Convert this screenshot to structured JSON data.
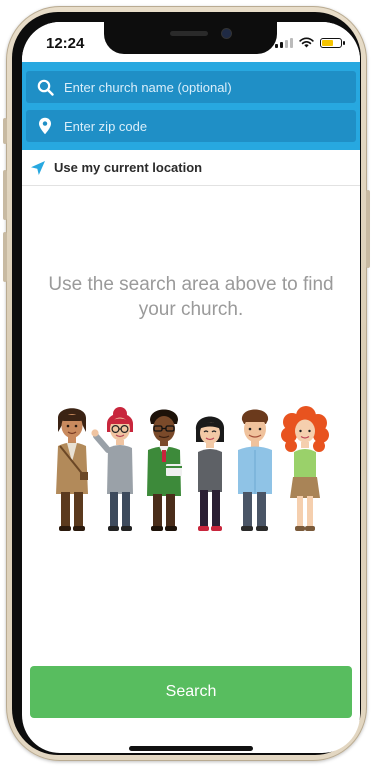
{
  "status_bar": {
    "time": "12:24",
    "battery_level": 0.7
  },
  "search": {
    "church_name_placeholder": "Enter church name (optional)",
    "church_name_value": "",
    "zip_placeholder": "Enter zip code",
    "zip_value": "",
    "search_icon": "search-icon",
    "zip_icon": "map-pin-icon"
  },
  "location": {
    "label": "Use my current location",
    "icon": "location-arrow-icon"
  },
  "hint": {
    "text": "Use the search area above to find your church."
  },
  "illustration": {
    "name": "people-group-illustration"
  },
  "action": {
    "search_label": "Search"
  },
  "colors": {
    "header": "#27a8e0",
    "field": "#1f8fc6",
    "button": "#58bd5f",
    "hint_text": "#9a9a9a"
  }
}
